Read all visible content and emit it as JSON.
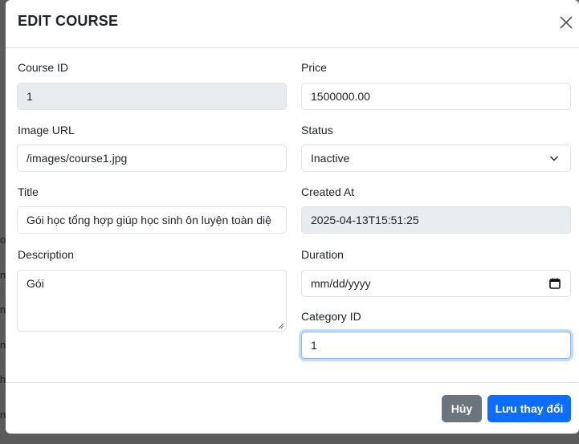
{
  "modal": {
    "title": "EDIT COURSE"
  },
  "form": {
    "course_id": {
      "label": "Course ID",
      "value": "1"
    },
    "price": {
      "label": "Price",
      "value": "1500000.00"
    },
    "image_url": {
      "label": "Image URL",
      "value": "/images/course1.jpg"
    },
    "status": {
      "label": "Status",
      "value": "Inactive"
    },
    "title": {
      "label": "Title",
      "value": "Gói học tổng hợp giúp học sinh ôn luyện toàn diệ"
    },
    "created_at": {
      "label": "Created At",
      "value": "2025-04-13T15:51:25"
    },
    "description": {
      "label": "Description",
      "value": "Gói"
    },
    "duration": {
      "label": "Duration",
      "placeholder": "mm/dd/yyyy"
    },
    "category_id": {
      "label": "Category ID",
      "value": "1"
    }
  },
  "footer": {
    "cancel_label": "Hủy",
    "save_label": "Lưu thay đổi"
  },
  "icons": {
    "close": "close-icon",
    "select": "chevron-down-icon",
    "calendar": "calendar-icon"
  },
  "colors": {
    "primary": "#0d6efd",
    "secondary": "#6c757d",
    "readonly_bg": "#e9ecef",
    "border": "#dee2e6"
  }
}
